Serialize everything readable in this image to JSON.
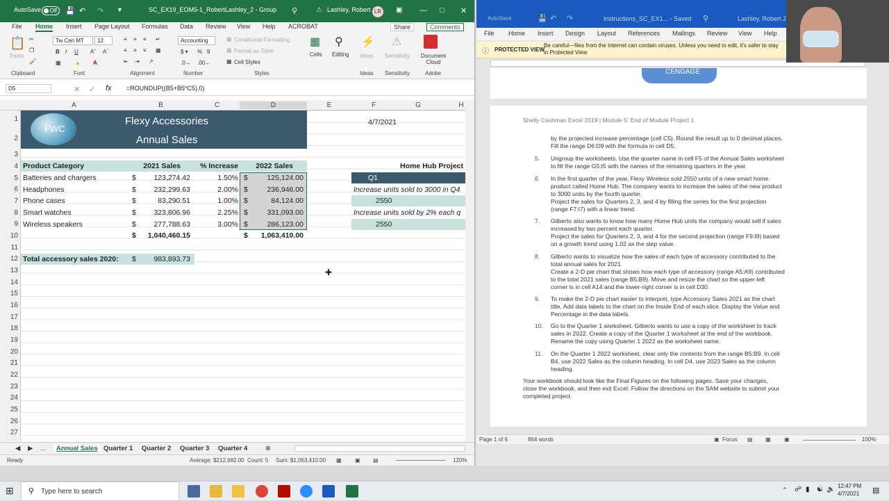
{
  "excel": {
    "autosave_label": "AutoSave",
    "autosave_state": "Off",
    "title": "SC_EX19_EOM5-1_RobertLashley_2 - Group",
    "user": "Lashley, Robert J",
    "user_initials": "LR",
    "tabs": [
      "File",
      "Home",
      "Insert",
      "Page Layout",
      "Formulas",
      "Data",
      "Review",
      "View",
      "Help",
      "ACROBAT"
    ],
    "share": "Share",
    "comments": "Comments",
    "ribbon": {
      "paste": "Paste",
      "font_name": "Tw Cen MT",
      "font_size": "12",
      "number_format": "Accounting",
      "conditional_formatting": "Conditional Formatting",
      "format_as_table": "Format as Table",
      "cell_styles": "Cell Styles",
      "cells": "Cells",
      "editing": "Editing",
      "ideas": "Ideas",
      "sensitivity": "Sensitivity",
      "document_cloud": "Document Cloud",
      "groups": [
        "Clipboard",
        "Font",
        "Alignment",
        "Number",
        "Styles",
        "Ideas",
        "Sensitivity",
        "Adobe"
      ]
    },
    "name_box": "D5",
    "formula": "=ROUNDUP((B5+B5*C5),0)",
    "columns": [
      "A",
      "B",
      "C",
      "D",
      "E",
      "F",
      "G",
      "H"
    ],
    "rows": [
      "1",
      "2",
      "3",
      "4",
      "5",
      "6",
      "7",
      "8",
      "9",
      "10",
      "11",
      "12",
      "13",
      "14",
      "15",
      "16",
      "17",
      "18",
      "19",
      "20",
      "21",
      "22",
      "23",
      "24",
      "25",
      "26",
      "27"
    ],
    "logo_text": "FWC",
    "sheet_title": "Flexy Accessories",
    "sheet_subtitle": "Annual Sales",
    "date": "4/7/2021",
    "headers": {
      "category": "Product Category",
      "sales2021": "2021 Sales",
      "increase": "% Increase",
      "sales2022": "2022 Sales"
    },
    "table": [
      {
        "category": "Batteries and chargers",
        "s2021": "123,274.42",
        "inc": "1.50%",
        "s2022": "125,124.00"
      },
      {
        "category": "Headphones",
        "s2021": "232,299.63",
        "inc": "2.00%",
        "s2022": "236,946.00"
      },
      {
        "category": "Phone cases",
        "s2021": "83,290.51",
        "inc": "1.00%",
        "s2022": "84,124.00"
      },
      {
        "category": "Smart watches",
        "s2021": "323,806.96",
        "inc": "2.25%",
        "s2022": "331,093.00"
      },
      {
        "category": "Wireless speakers",
        "s2021": "277,788.63",
        "inc": "3.00%",
        "s2022": "286,123.00"
      }
    ],
    "currency": "$",
    "total2021": "1,040,460.15",
    "total2022": "1,063,410.00",
    "total_label": "Total accessory sales 2020:",
    "total_value": "983,893.73",
    "home_hub": {
      "title": "Home Hub Project",
      "q": "Q1",
      "line1": "Increase units sold to 3000 in Q4",
      "v1": "2550",
      "line2": "Increase units sold by 2% each q",
      "v2": "2550"
    },
    "sheet_tabs": [
      "...",
      "Annual Sales",
      "Quarter 1",
      "Quarter 2",
      "Quarter 3",
      "Quarter 4"
    ],
    "status": {
      "ready": "Ready",
      "average": "Average: $212,682.00",
      "count": "Count: 5",
      "sum": "Sum: $1,063,410.00",
      "zoom": "120%"
    }
  },
  "word": {
    "autosave_label": "AutoSave",
    "title": "Instructions_SC_EX1...  -  Saved",
    "user": "Lashley, Robert J",
    "tabs": [
      "File",
      "Home",
      "Insert",
      "Design",
      "Layout",
      "References",
      "Mailings",
      "Review",
      "View",
      "Help"
    ],
    "protected_label": "PROTECTED VIEW",
    "protected_msg": "Be careful—files from the Internet can contain viruses. Unless you need to edit, it's safer to stay in Protected View.",
    "cengage": "CENGAGE",
    "page_header": "Shelly Cashman Excel 2019 | Module 5: End of Module Project 1",
    "lines": [
      {
        "n": "",
        "t": "by the projected increase percentage (cell C5). Round the result up to 0 decimal places."
      },
      {
        "n": "",
        "t": "Fill the range D6:D9 with the formula in cell D5."
      },
      {
        "n": "5.",
        "t": "Ungroup the worksheets. Use the quarter name in cell F5 of the Annual Sales worksheet"
      },
      {
        "n": "",
        "t": "to fill the range G5:I5 with the names of the remaining quarters in the year."
      },
      {
        "n": "6.",
        "t": "In the first quarter of the year, Flexy Wireless sold 2550 units of a new smart home"
      },
      {
        "n": "",
        "t": "product called Home Hub. The company wants to increase the sales of the new product"
      },
      {
        "n": "",
        "t": "to 3000 units by the fourth quarter."
      },
      {
        "n": "",
        "t": "Project the sales for Quarters 2, 3, and 4 by filling the series for the first projection"
      },
      {
        "n": "",
        "t": "(range F7:I7) with a linear trend."
      },
      {
        "n": "7.",
        "t": "Gilberto also wants to know how many Home Hub units the company would sell if sales"
      },
      {
        "n": "",
        "t": "increased by two percent each quarter."
      },
      {
        "n": "",
        "t": "Project the sales for Quarters 2, 3, and 4 for the second projection (range F9:I9) based"
      },
      {
        "n": "",
        "t": "on a growth trend using 1.02 as the step value."
      },
      {
        "n": "8.",
        "t": "Gilberto wants to visualize how the sales of each type of accessory contributed to the"
      },
      {
        "n": "",
        "t": "total annual sales for 2021."
      },
      {
        "n": "",
        "t": "Create a 2-D pie chart that shows how each type of accessory (range A5:A9) contributed"
      },
      {
        "n": "",
        "t": "to the total 2021 sales (range B5:B9). Move and resize the chart so the upper-left"
      },
      {
        "n": "",
        "t": "corner is in cell A14 and the lower-right corner is in cell D30."
      },
      {
        "n": "9.",
        "t": "To make the 2-D pie chart easier to interpret, type Accessory Sales 2021 as the chart"
      },
      {
        "n": "",
        "t": "title. Add data labels to the chart on the Inside End of each slice. Display the Value and"
      },
      {
        "n": "",
        "t": "Percentage in the data labels."
      },
      {
        "n": "10.",
        "t": "Go to the Quarter 1 worksheet. Gilberto wants to use a copy of the worksheet to track"
      },
      {
        "n": "",
        "t": "sales in 2022. Create a copy of the Quarter 1 worksheet at the end of the workbook."
      },
      {
        "n": "",
        "t": "Rename the copy using Quarter 1 2022 as the worksheet name."
      },
      {
        "n": "11.",
        "t": "On the Quarter 1 2022 worksheet, clear only the contents from the range B5:B9. In cell"
      },
      {
        "n": "",
        "t": "B4, use 2022 Sales as the column heading. In cell D4, use 2023 Sales as the column"
      },
      {
        "n": "",
        "t": "heading."
      },
      {
        "n": "",
        "t": "Your workbook should look like the Final Figures on the following pages. Save your changes,"
      },
      {
        "n": "",
        "t": "close the workbook, and then exit Excel. Follow the directions on the SAM website to submit your"
      },
      {
        "n": "",
        "t": "completed project."
      }
    ],
    "status": {
      "page": "Page 1 of 6",
      "words": "864 words",
      "focus": "Focus",
      "zoom": "100%"
    }
  },
  "taskbar": {
    "search_placeholder": "Type here to search",
    "time": "12:47 PM",
    "date": "4/7/2021"
  },
  "colors": {
    "excel_green": "#217346",
    "word_blue": "#185abd",
    "banner": "#3b5a6e",
    "header_fill": "#c7e1df"
  }
}
